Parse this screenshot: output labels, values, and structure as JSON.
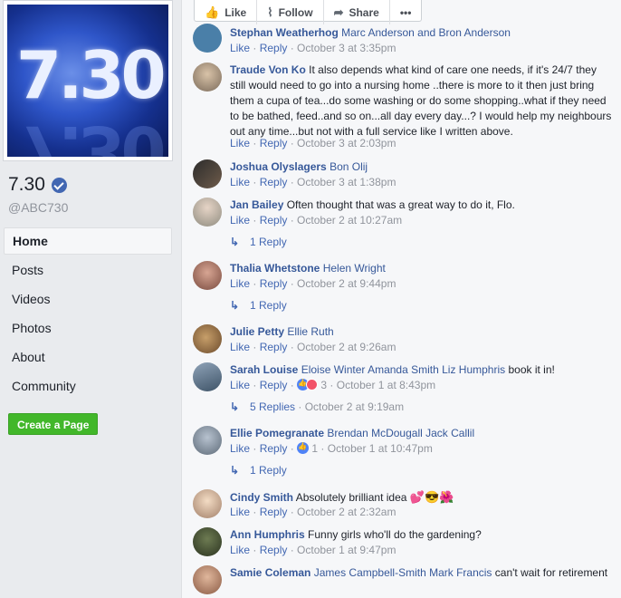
{
  "page": {
    "logo_text": "7.30",
    "name": "7.30",
    "handle": "@ABC730"
  },
  "nav": {
    "items": [
      {
        "label": "Home",
        "active": true
      },
      {
        "label": "Posts"
      },
      {
        "label": "Videos"
      },
      {
        "label": "Photos"
      },
      {
        "label": "About"
      },
      {
        "label": "Community"
      }
    ],
    "create_page": "Create a Page"
  },
  "actions": {
    "like": "Like",
    "follow": "Follow",
    "share": "Share",
    "more": "•••"
  },
  "common": {
    "like": "Like",
    "reply": "Reply",
    "sep": " · "
  },
  "comments": [
    {
      "author": "Stephan Weatherhog",
      "text": "",
      "tags": "Marc Anderson and Bron Anderson",
      "time": "October 3 at 3:35pm"
    },
    {
      "author": "Traude Von Ko",
      "text": "It also depends what kind of care one needs, if it's 24/7 they still would need to go into a nursing home ..there is more to it then just bring them a cupa of tea...do some washing or do some shopping..what if they need to be bathed, feed..and so on...all day every day...? I would help my neighbours out any time...but not with a full service like I written above.",
      "time": "October 3 at 2:03pm"
    },
    {
      "author": "Joshua Olyslagers",
      "tags": "Bon Olij",
      "time": "October 3 at 1:38pm"
    },
    {
      "author": "Jan Bailey",
      "text": "Often thought that was a great way to do it, Flo.",
      "time": "October 2 at 10:27am",
      "replies": "1 Reply"
    },
    {
      "author": "Thalia Whetstone",
      "tags": "Helen Wright",
      "time": "October 2 at 9:44pm",
      "replies": "1 Reply"
    },
    {
      "author": "Julie Petty",
      "tags": "Ellie Ruth",
      "time": "October 2 at 9:26am"
    },
    {
      "author": "Sarah Louise",
      "tags": "Eloise Winter Amanda Smith Liz Humphris",
      "text": "book it in!",
      "reactions": "3",
      "time": "October 1 at 8:43pm",
      "replies": "5 Replies",
      "replies_time": "October 2 at 9:19am"
    },
    {
      "author": "Ellie Pomegranate",
      "tags": "Brendan McDougall Jack Callil",
      "reactions": "1",
      "time": "October 1 at 10:47pm",
      "replies": "1 Reply"
    },
    {
      "author": "Cindy Smith",
      "text": "Absolutely brilliant idea",
      "emoji": "💕😎🌺",
      "time": "October 2 at 2:32am"
    },
    {
      "author": "Ann Humphris",
      "text": "Funny girls who'll do the gardening?",
      "time": "October 1 at 9:47pm"
    },
    {
      "author": "Samie Coleman",
      "tags": "James Campbell-Smith Mark Francis",
      "text": "can't wait for retirement"
    }
  ]
}
